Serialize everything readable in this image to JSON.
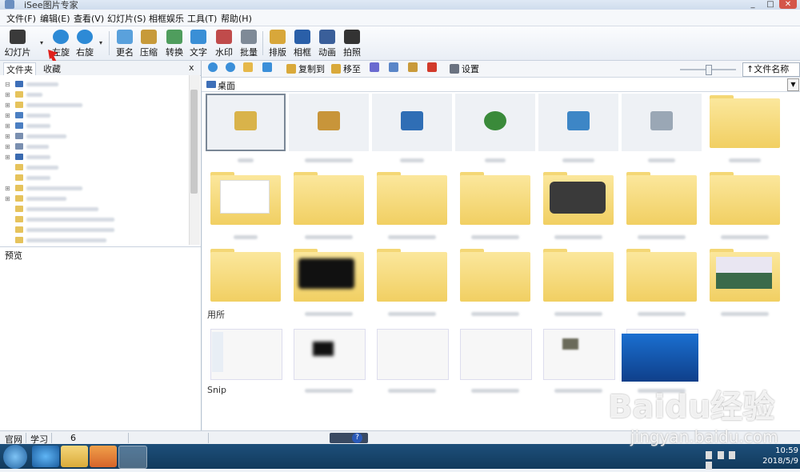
{
  "window": {
    "title": "iSee图片专家"
  },
  "menu": [
    "文件(F)",
    "编辑(E)",
    "查看(V)",
    "幻灯片(S)",
    "相框娱乐",
    "工具(T)",
    "帮助(H)"
  ],
  "toolbar": {
    "items": [
      {
        "label": "幻灯片",
        "icon": "slideshow-icon",
        "color": "#3a3a3a"
      },
      {
        "label": "左旋",
        "icon": "rotate-left-icon",
        "color": "#2d8ad6"
      },
      {
        "label": "右旋",
        "icon": "rotate-right-icon",
        "color": "#2d8ad6"
      },
      {
        "label": "更名",
        "icon": "rename-icon",
        "color": "#5aa1dc"
      },
      {
        "label": "压缩",
        "icon": "compress-icon",
        "color": "#c79a3a"
      },
      {
        "label": "转换",
        "icon": "convert-icon",
        "color": "#4f9d5d"
      },
      {
        "label": "文字",
        "icon": "text-icon",
        "color": "#3a8fd6"
      },
      {
        "label": "水印",
        "icon": "watermark-icon",
        "color": "#c04b4b"
      },
      {
        "label": "批量",
        "icon": "batch-icon",
        "color": "#7f8a97"
      },
      {
        "label": "排版",
        "icon": "layout-icon",
        "color": "#d8a73a"
      },
      {
        "label": "相框",
        "icon": "frame-icon",
        "color": "#2a5fa8"
      },
      {
        "label": "动画",
        "icon": "animation-icon",
        "color": "#3a5f9a"
      },
      {
        "label": "拍照",
        "icon": "camera-icon",
        "color": "#333"
      }
    ]
  },
  "left_panel": {
    "tabs": [
      "文件夹",
      "收藏"
    ],
    "lower_label": "预览"
  },
  "right_toolbar": {
    "buttons": [
      {
        "label": "",
        "icon": "back-icon",
        "color": "#3b8fd9"
      },
      {
        "label": "",
        "icon": "forward-icon",
        "color": "#3b8fd9"
      },
      {
        "label": "",
        "icon": "up-folder-icon",
        "color": "#e6b84a"
      },
      {
        "label": "",
        "icon": "refresh-icon",
        "color": "#3b8fd9"
      },
      {
        "label": "复制到",
        "icon": "copy-to-icon",
        "color": "#d9a93a"
      },
      {
        "label": "移至",
        "icon": "move-to-icon",
        "color": "#d9a93a"
      },
      {
        "label": "",
        "icon": "cut-icon",
        "color": "#6a6ad0"
      },
      {
        "label": "",
        "icon": "copy-icon",
        "color": "#5a86c8"
      },
      {
        "label": "",
        "icon": "paste-icon",
        "color": "#c99a3a"
      },
      {
        "label": "",
        "icon": "delete-icon",
        "color": "#d23a2a"
      },
      {
        "label": "设置",
        "icon": "settings-icon",
        "color": "#6a7280"
      }
    ],
    "sort_label": "↑文件名称"
  },
  "path": {
    "current": "桌面"
  },
  "thumbnails": {
    "row1": [
      {
        "kind": "icon",
        "icon": "library-icon",
        "color": "#d9b34a"
      },
      {
        "kind": "icon",
        "icon": "user-folder-icon",
        "color": "#c8953a"
      },
      {
        "kind": "icon",
        "icon": "computer-icon",
        "color": "#2f6eb5"
      },
      {
        "kind": "icon",
        "icon": "network-icon",
        "color": "#3a8a3a"
      },
      {
        "kind": "icon",
        "icon": "control-panel-icon",
        "color": "#3d86c6"
      },
      {
        "kind": "icon",
        "icon": "recycle-bin-icon",
        "color": "#9aa7b5"
      },
      {
        "kind": "folder"
      }
    ],
    "row3_visible_caption": "用所",
    "row4_visible_caption": "Snip"
  },
  "statusbar": {
    "items": [
      "官网",
      "学习",
      "6"
    ]
  },
  "clock": {
    "time": "10:59",
    "date": "2018/5/9"
  },
  "watermark": {
    "brand": "Baidu经验",
    "url": "jingyan.baidu.com"
  }
}
